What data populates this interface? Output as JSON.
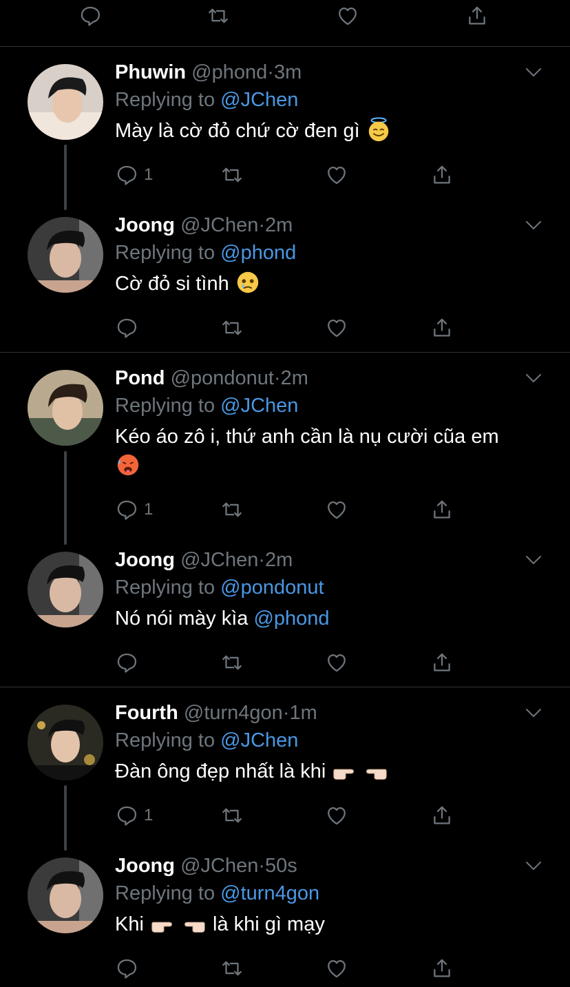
{
  "colors": {
    "background": "#000000",
    "text": "#ffffff",
    "muted": "#6e767d",
    "link": "#4a98e4",
    "divider": "#2f3336"
  },
  "top_actions": [
    "reply-icon",
    "retweet-icon",
    "like-icon",
    "share-icon"
  ],
  "replying_label": "Replying to",
  "tweets": [
    {
      "name": "Phuwin",
      "handle": "@phond",
      "dot": "·",
      "time": "3m",
      "replying_to": "@JChen",
      "text": "Mày là cờ đỏ chứ cờ đen gì",
      "emoji": "smiling-face-with-halo",
      "reply_count": "1"
    },
    {
      "name": "Joong",
      "handle": "@JChen",
      "dot": "·",
      "time": "2m",
      "replying_to": "@phond",
      "text": "Cờ đỏ si tình",
      "emoji": "face-holding-back-tears",
      "reply_count": ""
    },
    {
      "name": "Pond",
      "handle": "@pondonut",
      "dot": "·",
      "time": "2m",
      "replying_to": "@JChen",
      "text": "Kéo áo zô i, thứ anh cần là nụ cười cũa em",
      "emoji": "hot-face",
      "reply_count": "1"
    },
    {
      "name": "Joong",
      "handle": "@JChen",
      "dot": "·",
      "time": "2m",
      "replying_to": "@pondonut",
      "text": "Nó nói mày kìa",
      "mention": "@phond",
      "reply_count": ""
    },
    {
      "name": "Fourth",
      "handle": "@turn4gon",
      "dot": "·",
      "time": "1m",
      "replying_to": "@JChen",
      "text": "Đàn ông đẹp nhất là khi",
      "emoji": "pointing-hands",
      "reply_count": "1"
    },
    {
      "name": "Joong",
      "handle": "@JChen",
      "dot": "·",
      "time": "50s",
      "replying_to": "@turn4gon",
      "text_before": "Khi",
      "text_after": "là khi gì mạy",
      "emoji": "pointing-hands",
      "reply_count": ""
    }
  ]
}
